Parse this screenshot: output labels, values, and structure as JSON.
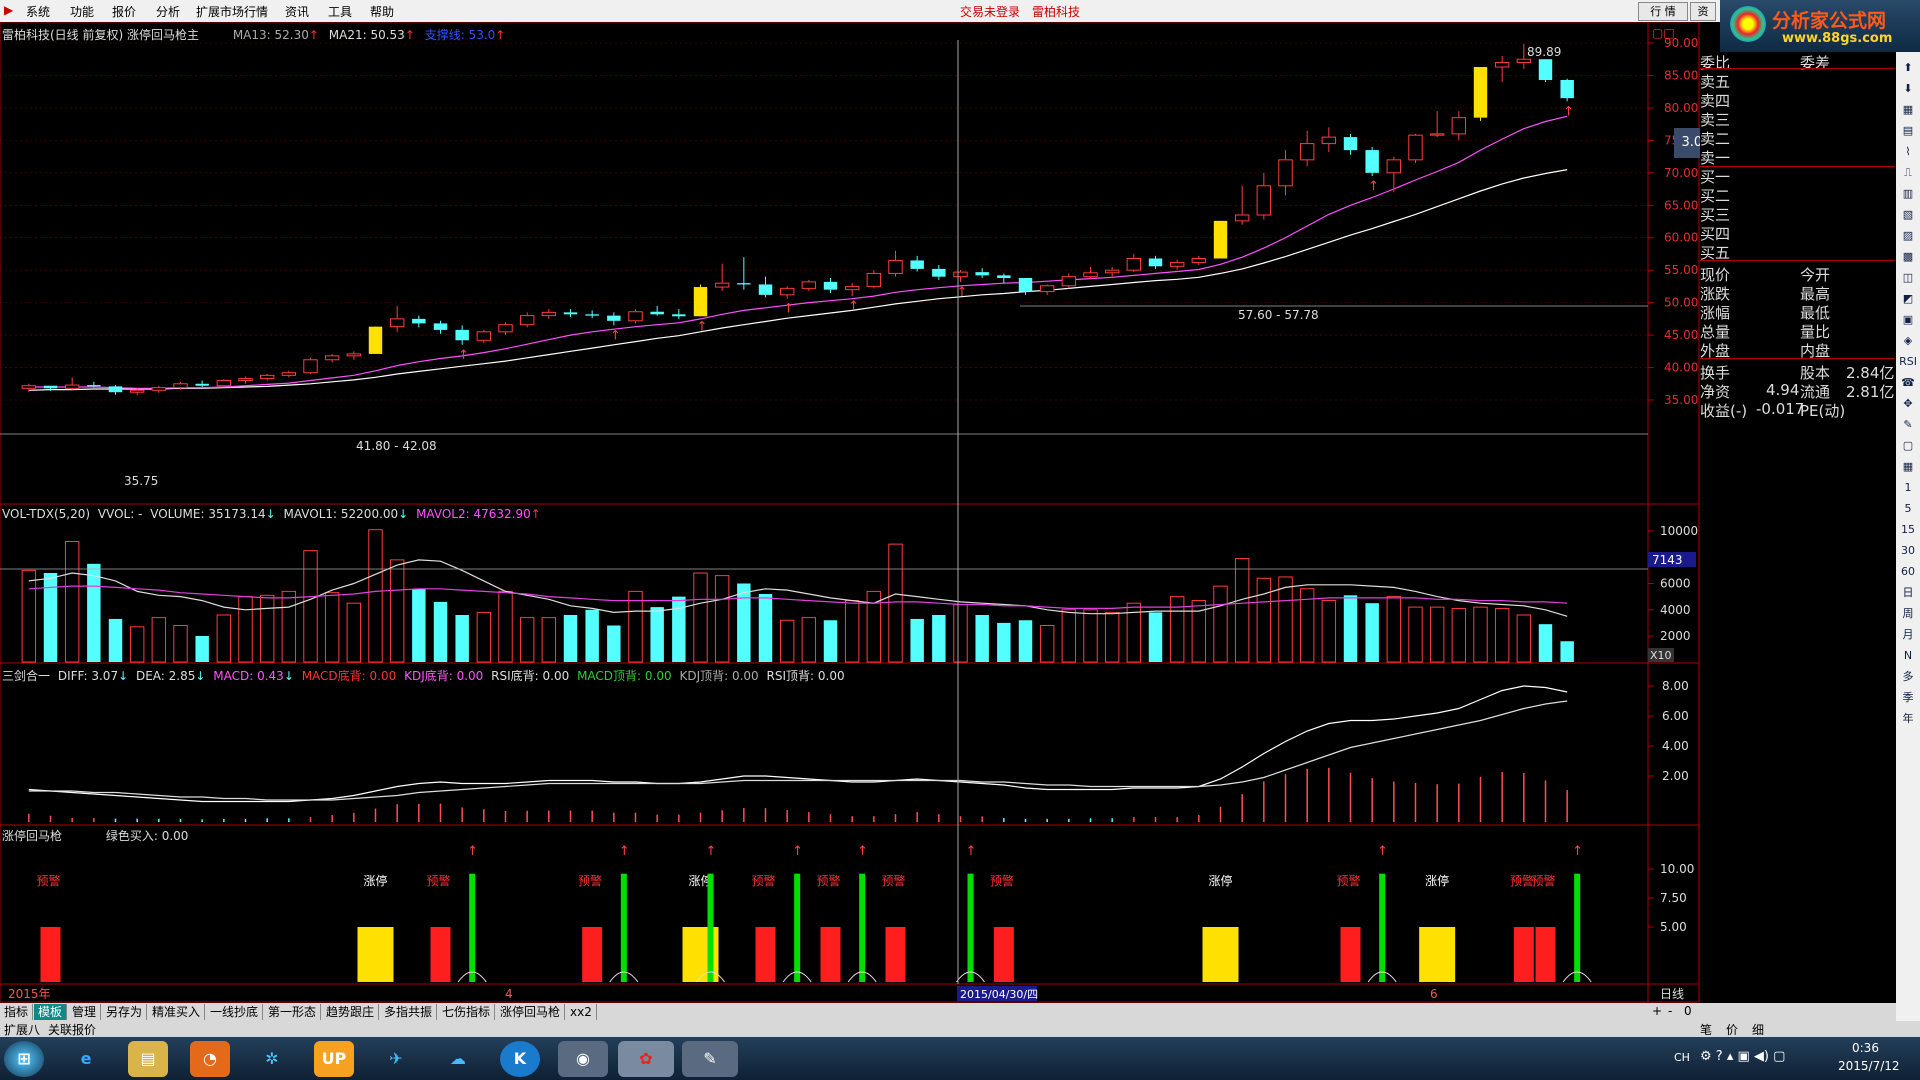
{
  "menu": {
    "items": [
      "系统",
      "功能",
      "报价",
      "分析",
      "扩展市场行情",
      "资讯",
      "工具",
      "帮助"
    ],
    "center_left": "交易未登录",
    "center_right": "雷柏科技",
    "btn_market": "行 情",
    "btn_info": "资"
  },
  "logo": {
    "title": "分析家公式网",
    "url": "www.88gs.com"
  },
  "main_header": {
    "title": "雷柏科技(日线 前复权) 涨停回马枪主",
    "ma13": "MA13: 52.30",
    "ma21": "MA21: 50.53",
    "support": "支撑线: 53.0"
  },
  "price_axis": [
    "90.00",
    "85.00",
    "80.00",
    "75.00",
    "70.00",
    "65.00",
    "60.00",
    "55.00",
    "50.00",
    "45.00",
    "40.00",
    "35.00"
  ],
  "price_labels": {
    "high": "89.89",
    "low": "35.75",
    "zone1": "41.80 - 42.08",
    "zone2": "57.60 - 57.78",
    "pct_badge": "3.0%"
  },
  "vol_header": {
    "name": "VOL-TDX(5,20)",
    "vvol": "VVOL: -",
    "volume": "VOLUME: 35173.14",
    "mavol1": "MAVOL1: 52200.00",
    "mavol2": "MAVOL2: 47632.90"
  },
  "vol_axis": [
    "10000",
    "6000",
    "4000",
    "2000"
  ],
  "vol_badge": "7143",
  "vol_unit": "X10",
  "macd_header": {
    "name": "三剑合一",
    "diff": "DIFF: 3.07",
    "dea": "DEA: 2.85",
    "macd": "MACD: 0.43",
    "macd_bottom": "MACD底背: 0.00",
    "kdj_bottom": "KDJ底背: 0.00",
    "rsi_bottom": "RSI底背: 0.00",
    "macd_top": "MACD顶背: 0.00",
    "kdj_top": "KDJ顶背: 0.00",
    "rsi_top": "RSI顶背: 0.00"
  },
  "macd_axis": [
    "8.00",
    "6.00",
    "4.00",
    "2.00"
  ],
  "signal_header": {
    "name": "涨停回马枪",
    "green_buy": "绿色买入: 0.00"
  },
  "signal_axis": [
    "10.00",
    "7.50",
    "5.00"
  ],
  "signal_labels": {
    "warn": "预警",
    "limit": "涨停"
  },
  "time_axis": {
    "year": "2015年",
    "m4": "4",
    "m6": "6",
    "cursor": "2015/04/30/四",
    "period": "日线"
  },
  "quote": {
    "left_col": [
      "委比",
      "卖五",
      "卖四",
      "卖三",
      "卖二",
      "卖一",
      "买一",
      "买二",
      "买三",
      "买四",
      "买五",
      "现价",
      "涨跌",
      "涨幅",
      "总量",
      "外盘",
      "换手",
      "净资",
      "收益(-)"
    ],
    "right_col": [
      "委差",
      "",
      "",
      "",
      "",
      "",
      "",
      "",
      "",
      "",
      "",
      "今开",
      "最高",
      "最低",
      "量比",
      "内盘",
      "股本",
      "流通",
      "PE(动)"
    ],
    "values": {
      "turnover": "2.84亿",
      "netasset": "4.94",
      "float": "2.81亿",
      "eps": "-0.017"
    }
  },
  "tabs": [
    "指标",
    "模板",
    "管理",
    "另存为",
    "精准买入",
    "一线抄底",
    "第一形态",
    "趋势跟庄",
    "多指共振",
    "七伤指标",
    "涨停回马枪",
    "xx2"
  ],
  "tabs_row2": [
    "扩展八",
    "关联报价"
  ],
  "tabs_right": [
    "+",
    "-",
    "0"
  ],
  "tray_right": [
    "笔",
    "价",
    "细"
  ],
  "taskbar": {
    "time": "0:36",
    "date": "2015/7/12",
    "lang": "CH"
  },
  "colors": {
    "up": "#ff3c3c",
    "down": "#54ffff",
    "limit": "#ffe000",
    "ma1": "#ffffff",
    "ma2": "#ff50ff",
    "axis": "#b00000",
    "signal_green": "#00e000"
  },
  "chart_data": {
    "type": "candlestick",
    "candles": [
      [
        36.8,
        37.5,
        36.2,
        37.2
      ],
      [
        37.2,
        37.0,
        36.4,
        36.8
      ],
      [
        36.8,
        38.5,
        36.5,
        37.3
      ],
      [
        37.3,
        37.8,
        36.9,
        37.1
      ],
      [
        37.1,
        37.3,
        35.8,
        36.2
      ],
      [
        36.2,
        36.8,
        35.75,
        36.5
      ],
      [
        36.5,
        37.2,
        36.1,
        36.9
      ],
      [
        36.9,
        37.8,
        36.6,
        37.5
      ],
      [
        37.5,
        38.0,
        37.0,
        37.2
      ],
      [
        37.2,
        38.2,
        37.0,
        38.0
      ],
      [
        38.0,
        38.6,
        37.5,
        38.3
      ],
      [
        38.3,
        39.0,
        38.0,
        38.8
      ],
      [
        38.8,
        39.5,
        38.5,
        39.2
      ],
      [
        39.2,
        41.5,
        39.0,
        41.2
      ],
      [
        41.2,
        42.1,
        40.8,
        41.8
      ],
      [
        41.8,
        42.5,
        41.2,
        42.1
      ],
      [
        42.1,
        46.3,
        42.1,
        46.3
      ],
      [
        46.3,
        49.5,
        45.5,
        47.5
      ],
      [
        47.5,
        48.0,
        46.2,
        46.8
      ],
      [
        46.8,
        47.2,
        45.2,
        45.8
      ],
      [
        45.8,
        46.5,
        43.5,
        44.2
      ],
      [
        44.2,
        45.8,
        43.8,
        45.5
      ],
      [
        45.5,
        47.0,
        45.0,
        46.6
      ],
      [
        46.6,
        48.5,
        46.2,
        48.0
      ],
      [
        48.0,
        49.0,
        47.5,
        48.5
      ],
      [
        48.5,
        49.0,
        47.8,
        48.2
      ],
      [
        48.2,
        48.8,
        47.6,
        48.0
      ],
      [
        48.0,
        48.5,
        46.5,
        47.2
      ],
      [
        47.2,
        49.0,
        46.8,
        48.6
      ],
      [
        48.6,
        49.5,
        48.0,
        48.2
      ],
      [
        48.2,
        49.0,
        47.5,
        47.9
      ],
      [
        47.9,
        52.8,
        47.9,
        52.4
      ],
      [
        52.4,
        56.0,
        51.8,
        53.0
      ],
      [
        53.0,
        57.0,
        52.0,
        52.8
      ],
      [
        52.8,
        54.0,
        50.8,
        51.2
      ],
      [
        51.2,
        52.5,
        50.6,
        52.2
      ],
      [
        52.2,
        53.5,
        51.8,
        53.2
      ],
      [
        53.2,
        53.8,
        51.5,
        52.0
      ],
      [
        52.0,
        53.0,
        51.0,
        52.5
      ],
      [
        52.5,
        55.0,
        52.2,
        54.5
      ],
      [
        54.5,
        58.0,
        54.0,
        56.5
      ],
      [
        56.5,
        57.2,
        54.8,
        55.2
      ],
      [
        55.2,
        55.8,
        53.5,
        54.0
      ],
      [
        54.0,
        55.0,
        53.2,
        54.7
      ],
      [
        54.7,
        55.3,
        53.8,
        54.2
      ],
      [
        54.2,
        54.5,
        53.0,
        53.8
      ],
      [
        53.8,
        53.8,
        51.2,
        51.7
      ],
      [
        51.7,
        52.8,
        51.2,
        52.6
      ],
      [
        52.6,
        54.5,
        52.2,
        54.0
      ],
      [
        54.0,
        55.5,
        53.6,
        54.6
      ],
      [
        54.6,
        55.5,
        53.8,
        55.0
      ],
      [
        55.0,
        57.5,
        54.7,
        56.8
      ],
      [
        56.8,
        57.2,
        55.2,
        55.6
      ],
      [
        55.6,
        56.6,
        55.1,
        56.2
      ],
      [
        56.2,
        57.2,
        55.8,
        56.8
      ],
      [
        56.8,
        62.6,
        56.8,
        62.6
      ],
      [
        62.6,
        68.0,
        62.0,
        63.5
      ],
      [
        63.5,
        70.0,
        62.8,
        68.0
      ],
      [
        68.0,
        73.5,
        66.5,
        72.0
      ],
      [
        72.0,
        76.5,
        71.0,
        74.5
      ],
      [
        74.5,
        77.0,
        73.2,
        75.5
      ],
      [
        75.5,
        76.0,
        72.8,
        73.5
      ],
      [
        73.5,
        74.0,
        69.5,
        70.0
      ],
      [
        70.0,
        72.5,
        67.0,
        72.0
      ],
      [
        72.0,
        76.0,
        71.5,
        75.8
      ],
      [
        75.8,
        79.5,
        75.5,
        76.0
      ],
      [
        76.0,
        79.5,
        75.0,
        78.5
      ],
      [
        78.5,
        86.3,
        78.0,
        86.3
      ],
      [
        86.3,
        88.0,
        84.0,
        87.0
      ],
      [
        87.0,
        89.89,
        86.0,
        87.5
      ],
      [
        87.5,
        87.5,
        84.0,
        84.3
      ],
      [
        84.3,
        84.5,
        81.0,
        81.5
      ]
    ],
    "limit_up_days": [
      16,
      31,
      55,
      67
    ],
    "ma13": [
      37.0,
      37.0,
      37.0,
      37.0,
      36.9,
      36.8,
      36.8,
      36.9,
      36.9,
      37.0,
      37.2,
      37.4,
      37.6,
      38.0,
      38.4,
      38.8,
      39.5,
      40.3,
      40.9,
      41.4,
      41.8,
      42.3,
      42.9,
      43.6,
      44.3,
      45.0,
      45.5,
      45.9,
      46.3,
      46.6,
      46.9,
      47.5,
      48.2,
      48.8,
      49.2,
      49.6,
      50.0,
      50.3,
      50.6,
      51.0,
      51.6,
      52.0,
      52.3,
      52.6,
      52.8,
      53.0,
      53.1,
      53.3,
      53.5,
      53.7,
      53.9,
      54.2,
      54.5,
      54.8,
      55.1,
      55.9,
      57.0,
      58.4,
      60.0,
      61.8,
      63.6,
      65.0,
      66.2,
      67.5,
      68.9,
      70.2,
      71.6,
      73.5,
      75.2,
      76.8,
      77.9,
      78.7
    ],
    "ma21": [
      36.5,
      36.6,
      36.6,
      36.7,
      36.7,
      36.7,
      36.7,
      36.8,
      36.8,
      36.9,
      37.0,
      37.1,
      37.3,
      37.5,
      37.8,
      38.1,
      38.5,
      39.0,
      39.4,
      39.8,
      40.2,
      40.6,
      41.0,
      41.5,
      42.0,
      42.5,
      43.0,
      43.5,
      44.0,
      44.5,
      44.9,
      45.5,
      46.1,
      46.6,
      47.1,
      47.6,
      48.0,
      48.4,
      48.8,
      49.3,
      49.8,
      50.2,
      50.6,
      50.9,
      51.2,
      51.4,
      51.7,
      51.9,
      52.2,
      52.5,
      52.8,
      53.1,
      53.4,
      53.6,
      53.9,
      54.5,
      55.2,
      56.1,
      57.1,
      58.2,
      59.3,
      60.4,
      61.4,
      62.5,
      63.6,
      64.8,
      66.0,
      67.2,
      68.3,
      69.2,
      69.9,
      70.5
    ],
    "volumes": [
      7000,
      6800,
      9200,
      7500,
      3300,
      2700,
      3400,
      2800,
      2000,
      3600,
      5000,
      5100,
      5400,
      8500,
      5300,
      4500,
      10100,
      7800,
      5600,
      4600,
      3600,
      3800,
      5400,
      3400,
      3400,
      3600,
      4000,
      2800,
      5400,
      4200,
      5000,
      6800,
      6600,
      6000,
      5200,
      3200,
      3400,
      3200,
      4700,
      5400,
      9000,
      3300,
      3600,
      4400,
      3600,
      3000,
      3200,
      2800,
      4000,
      4000,
      3800,
      4500,
      3800,
      5000,
      4700,
      5800,
      7900,
      6400,
      6500,
      5600,
      4700,
      5100,
      4500,
      5000,
      4200,
      4200,
      4100,
      4200,
      4100,
      3600,
      2900,
      1600
    ],
    "vol_ma1": [
      6200,
      6400,
      6800,
      6600,
      6200,
      5400,
      5100,
      5000,
      4700,
      4200,
      4000,
      4100,
      4200,
      4800,
      5500,
      6000,
      6700,
      7400,
      7800,
      7700,
      7000,
      6200,
      5400,
      5100,
      4800,
      4300,
      4100,
      3800,
      3900,
      3900,
      4100,
      4500,
      4800,
      5300,
      5600,
      5500,
      5200,
      4900,
      4700,
      4500,
      5200,
      5000,
      4800,
      4600,
      4500,
      4400,
      4300,
      4000,
      3800,
      3700,
      3700,
      3800,
      3900,
      3900,
      3900,
      4300,
      4800,
      5200,
      5700,
      5900,
      5900,
      5900,
      5800,
      5700,
      5400,
      5000,
      4700,
      4500,
      4400,
      4300,
      4000,
      3500
    ],
    "vol_ma2": [
      5600,
      5700,
      5800,
      5800,
      5700,
      5600,
      5500,
      5300,
      5200,
      5100,
      5000,
      4900,
      4900,
      5000,
      5100,
      5200,
      5400,
      5500,
      5600,
      5600,
      5500,
      5400,
      5300,
      5200,
      5000,
      4900,
      4800,
      4700,
      4700,
      4700,
      4700,
      4800,
      4800,
      4900,
      4900,
      4800,
      4700,
      4600,
      4500,
      4500,
      4600,
      4600,
      4500,
      4400,
      4400,
      4300,
      4300,
      4200,
      4100,
      4100,
      4100,
      4200,
      4200,
      4200,
      4300,
      4400,
      4500,
      4600,
      4700,
      4800,
      4900,
      4900,
      4900,
      4900,
      4900,
      4800,
      4800,
      4700,
      4700,
      4600,
      4600,
      4500
    ],
    "diff": [
      1.1,
      1.0,
      0.9,
      0.8,
      0.7,
      0.6,
      0.5,
      0.4,
      0.3,
      0.3,
      0.3,
      0.3,
      0.3,
      0.4,
      0.5,
      0.7,
      1.0,
      1.3,
      1.5,
      1.6,
      1.5,
      1.5,
      1.5,
      1.6,
      1.7,
      1.7,
      1.7,
      1.6,
      1.6,
      1.5,
      1.5,
      1.6,
      1.8,
      2.0,
      2.0,
      1.9,
      1.8,
      1.7,
      1.6,
      1.6,
      1.7,
      1.8,
      1.7,
      1.6,
      1.5,
      1.4,
      1.2,
      1.1,
      1.1,
      1.1,
      1.1,
      1.2,
      1.2,
      1.2,
      1.3,
      1.8,
      2.6,
      3.5,
      4.3,
      5.0,
      5.5,
      5.7,
      5.7,
      5.8,
      6.0,
      6.2,
      6.5,
      7.1,
      7.7,
      8.0,
      7.9,
      7.6
    ],
    "dea": [
      1.0,
      1.0,
      1.0,
      0.9,
      0.9,
      0.8,
      0.7,
      0.6,
      0.6,
      0.5,
      0.5,
      0.4,
      0.4,
      0.4,
      0.4,
      0.5,
      0.6,
      0.7,
      0.9,
      1.0,
      1.1,
      1.2,
      1.3,
      1.4,
      1.5,
      1.5,
      1.5,
      1.5,
      1.5,
      1.5,
      1.5,
      1.5,
      1.6,
      1.7,
      1.7,
      1.7,
      1.7,
      1.7,
      1.7,
      1.7,
      1.7,
      1.7,
      1.7,
      1.7,
      1.6,
      1.6,
      1.5,
      1.4,
      1.4,
      1.3,
      1.3,
      1.3,
      1.3,
      1.3,
      1.3,
      1.4,
      1.6,
      1.9,
      2.4,
      2.9,
      3.4,
      3.9,
      4.2,
      4.5,
      4.8,
      5.1,
      5.4,
      5.7,
      6.1,
      6.5,
      6.8,
      7.0
    ],
    "warn_days": [
      1,
      19,
      26,
      34,
      37,
      40,
      45,
      61,
      69,
      70
    ],
    "limit_days": [
      16,
      31,
      55,
      65
    ],
    "buy_days": [
      20,
      27,
      31,
      35,
      38,
      43,
      62,
      71
    ]
  }
}
